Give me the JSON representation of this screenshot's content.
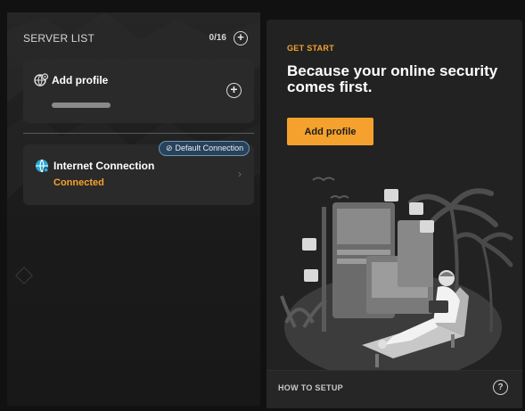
{
  "server_list": {
    "title": "SERVER LIST",
    "count": "0/16",
    "add_icon": "plus-circle-icon"
  },
  "add_profile_card": {
    "label": "Add profile",
    "icon": "globe-settings-icon",
    "plus_icon": "plus-circle-icon"
  },
  "connection_card": {
    "badge": "Default Connection",
    "badge_icon": "link-icon",
    "name": "Internet Connection",
    "status": "Connected",
    "icon": "globe-icon",
    "chevron_icon": "chevron-right-icon"
  },
  "promo": {
    "eyebrow": "GET START",
    "headline": "Because your online security comes first.",
    "button_label": "Add profile",
    "illustration": "person-relaxing-with-social-media-illustration"
  },
  "footer": {
    "label": "HOW TO SETUP",
    "help_glyph": "?",
    "help_icon": "question-circle-icon"
  },
  "colors": {
    "accent": "#f5a12d",
    "background": "#111111",
    "card": "#2a2a2a",
    "badge_bg": "#27425a",
    "badge_border": "#6d95b8",
    "connection_icon": "#29a9d8"
  }
}
